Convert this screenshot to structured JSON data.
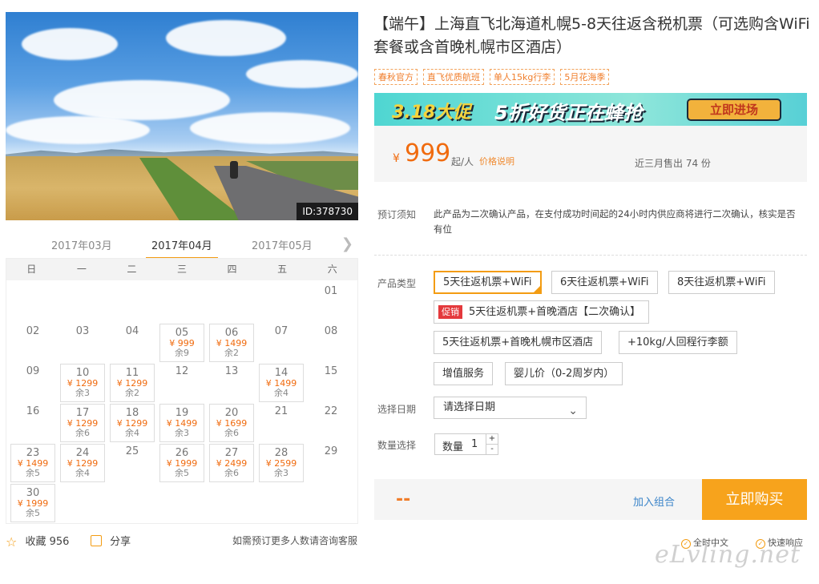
{
  "photo": {
    "id_tag": "ID:378730"
  },
  "months": [
    "2017年03月",
    "2017年04月",
    "2017年05月"
  ],
  "weekdays": [
    "日",
    "一",
    "二",
    "三",
    "四",
    "五",
    "六"
  ],
  "calendar": [
    {
      "d": "01"
    },
    {
      "d": "02"
    },
    {
      "d": "03"
    },
    {
      "d": "04"
    },
    {
      "d": "05",
      "p": "¥ 999",
      "r": "余9"
    },
    {
      "d": "06",
      "p": "¥ 1499",
      "r": "余2"
    },
    {
      "d": "07"
    },
    {
      "d": "08"
    },
    {
      "d": "09"
    },
    {
      "d": "10",
      "p": "¥ 1299",
      "r": "余3"
    },
    {
      "d": "11",
      "p": "¥ 1299",
      "r": "余2"
    },
    {
      "d": "12"
    },
    {
      "d": "13"
    },
    {
      "d": "14",
      "p": "¥ 1499",
      "r": "余4"
    },
    {
      "d": "15"
    },
    {
      "d": "16"
    },
    {
      "d": "17",
      "p": "¥ 1299",
      "r": "余6"
    },
    {
      "d": "18",
      "p": "¥ 1299",
      "r": "余4"
    },
    {
      "d": "19",
      "p": "¥ 1499",
      "r": "余3"
    },
    {
      "d": "20",
      "p": "¥ 1699",
      "r": "余6"
    },
    {
      "d": "21"
    },
    {
      "d": "22"
    },
    {
      "d": "23",
      "p": "¥ 1499",
      "r": "余5"
    },
    {
      "d": "24",
      "p": "¥ 1299",
      "r": "余4"
    },
    {
      "d": "25"
    },
    {
      "d": "26",
      "p": "¥ 1999",
      "r": "余5"
    },
    {
      "d": "27",
      "p": "¥ 2499",
      "r": "余6"
    },
    {
      "d": "28",
      "p": "¥ 2599",
      "r": "余3"
    },
    {
      "d": "29"
    },
    {
      "d": "30",
      "p": "¥ 1999",
      "r": "余5"
    }
  ],
  "actions": {
    "favorite": "收藏 956",
    "share": "分享",
    "note": "如需预订更多人数请咨询客服"
  },
  "product": {
    "title": "【端午】上海直飞北海道札幌5-8天往返含税机票（可选购含WiFi套餐或含首晚札幌市区酒店）",
    "tags": [
      "春秋官方",
      "直飞优质航班",
      "单人15kg行李",
      "5月花海季"
    ]
  },
  "banner": {
    "left": "3.18大促",
    "mid": "5折好货正在蜂抢",
    "button": "立即进场"
  },
  "price": {
    "currency": "¥",
    "amount": "999",
    "unit": "起/人",
    "explain": "价格说明",
    "sold": "近三月售出 74 份"
  },
  "notice": {
    "label": "预订须知",
    "text": "此产品为二次确认产品，在支付成功时间起的24小时内供应商将进行二次确认，核实是否有位"
  },
  "labels": {
    "type": "产品类型",
    "date": "选择日期",
    "qty": "数量选择"
  },
  "options": {
    "o1": "5天往返机票+WiFi",
    "o2": "6天往返机票+WiFi",
    "o3": "8天往返机票+WiFi",
    "promo": "促销",
    "o4": "5天往返机票+首晚酒店【二次确认】",
    "o5": "5天往返机票+首晚札幌市区酒店",
    "o6": "+10kg/人回程行李额",
    "o7": "增值服务",
    "o8": "婴儿价（0-2周岁内）"
  },
  "date_select": {
    "placeholder": "请选择日期"
  },
  "quantity": {
    "label": "数量",
    "value": "1",
    "plus": "+",
    "minus": "-"
  },
  "buy": {
    "price": "--",
    "add_combo": "加入组合",
    "buy_now": "立即购买"
  },
  "badges": [
    "全时中文",
    "快速响应"
  ],
  "watermark": "eLvling.net"
}
